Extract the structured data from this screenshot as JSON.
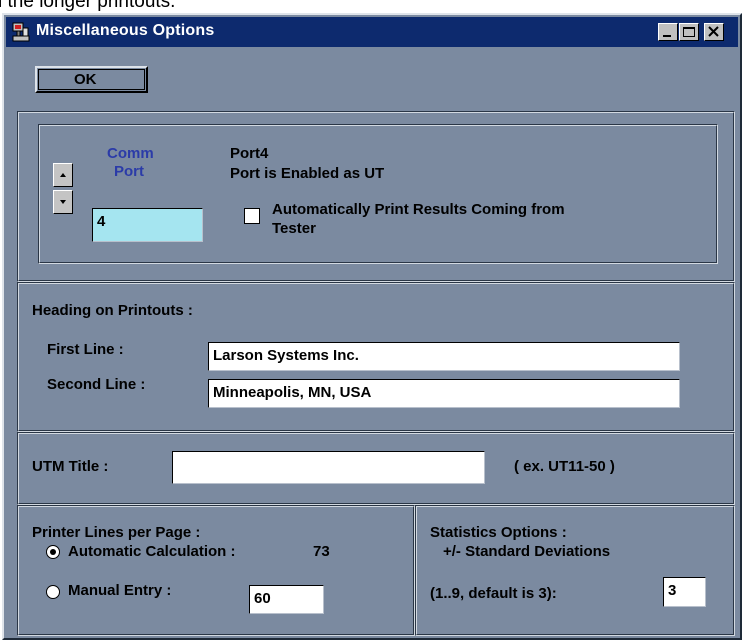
{
  "background_text": "l the longer printouts.",
  "window": {
    "title": "Miscellaneous Options",
    "controls": {
      "minimize": "_",
      "maximize": "□",
      "close": "✕"
    }
  },
  "ok_button": "OK",
  "comm": {
    "label_line1": "Comm",
    "label_line2": "Port",
    "port_value": "4",
    "port_name": "Port4",
    "port_status": "Port is Enabled as UT",
    "auto_print_line1": "Automatically Print Results Coming from",
    "auto_print_line2": "Tester",
    "auto_print_checked": false
  },
  "heading": {
    "label": "Heading on Printouts :",
    "first_line_label": "First Line :",
    "first_line_value": "Larson Systems Inc.",
    "second_line_label": "Second Line :",
    "second_line_value": "Minneapolis, MN, USA"
  },
  "utm": {
    "label": "UTM Title :",
    "value": "",
    "example": "( ex. UT11-50 )"
  },
  "printer": {
    "label": "Printer Lines per Page :",
    "auto_label": "Automatic Calculation :",
    "auto_value": "73",
    "manual_label": "Manual Entry :",
    "manual_value": "60",
    "selected": "automatic"
  },
  "stats": {
    "label": "Statistics Options :",
    "sub_label": "+/- Standard Deviations",
    "range_label": "(1..9, default is 3):",
    "value": "3"
  },
  "colors": {
    "titlebar": "#0d2a6e",
    "panel": "#7b8aa0",
    "field_highlight": "#a5e5f0",
    "comm_label": "#2b3ba8"
  }
}
